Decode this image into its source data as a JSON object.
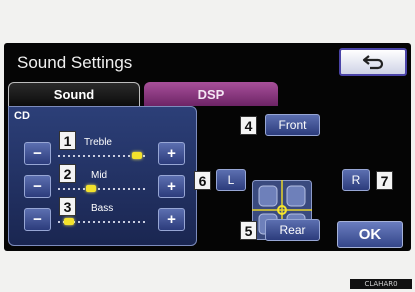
{
  "header": {
    "title": "Sound Settings"
  },
  "tabs": [
    {
      "label": "Sound",
      "active": true
    },
    {
      "label": "DSP",
      "active": false
    }
  ],
  "source": "CD",
  "eq": [
    {
      "index": "1",
      "label": "Treble",
      "level": 0.9
    },
    {
      "index": "2",
      "label": "Mid",
      "level": 0.38
    },
    {
      "index": "3",
      "label": "Bass",
      "level": 0.12
    }
  ],
  "buttons": {
    "minus": "−",
    "plus": "+",
    "ok": "OK"
  },
  "fader": {
    "front": {
      "index": "4",
      "label": "Front"
    },
    "rear": {
      "index": "5",
      "label": "Rear"
    },
    "left": {
      "index": "6",
      "label": "L"
    },
    "right": {
      "index": "7",
      "label": "R"
    }
  },
  "image_code": "CLAHAR0"
}
